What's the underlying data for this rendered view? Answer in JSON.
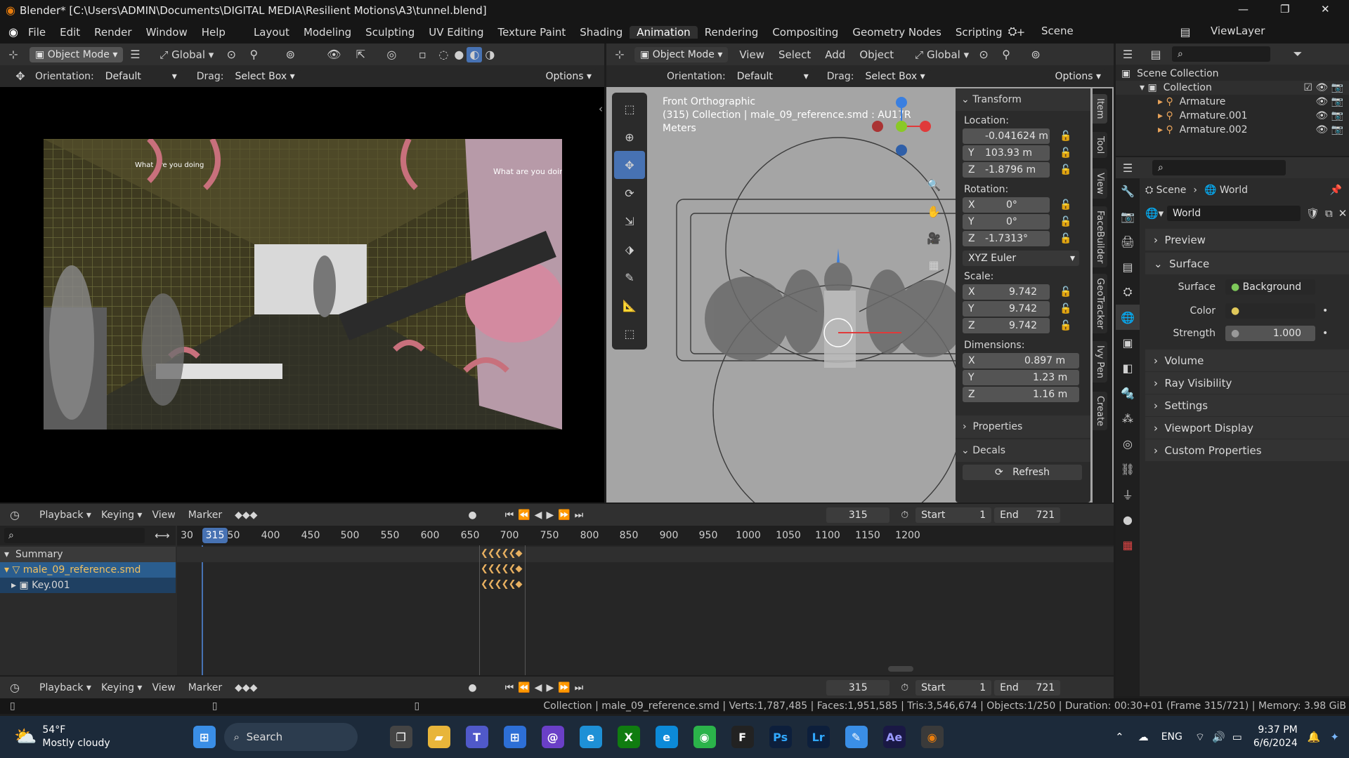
{
  "window": {
    "title": "Blender* [C:\\Users\\ADMIN\\Documents\\DIGITAL MEDIA\\Resilient Motions\\A3\\tunnel.blend]",
    "min": "—",
    "max": "❐",
    "close": "✕"
  },
  "menu": [
    "File",
    "Edit",
    "Render",
    "Window",
    "Help"
  ],
  "workspaces": [
    "Layout",
    "Modeling",
    "Sculpting",
    "UV Editing",
    "Texture Paint",
    "Shading",
    "Animation",
    "Rendering",
    "Compositing",
    "Geometry Nodes",
    "Scripting"
  ],
  "scene_name": "Scene",
  "view_layer": "ViewLayer",
  "left_view": {
    "mode": "Object Mode",
    "transform": "Global",
    "orientation_label": "Orientation:",
    "orientation": "Default",
    "drag_label": "Drag:",
    "drag": "Select Box",
    "options": "Options"
  },
  "right_view": {
    "mode": "Object Mode",
    "menus": [
      "View",
      "Select",
      "Add",
      "Object"
    ],
    "transform": "Global",
    "orientation_label": "Orientation:",
    "orientation": "Default",
    "drag_label": "Drag:",
    "drag": "Select Box",
    "options": "Options",
    "info1": "Front Orthographic",
    "info2": "(315) Collection | male_09_reference.smd : AU17R",
    "info3": "Meters"
  },
  "render_texts": {
    "sign1": "What are you doing",
    "sign2": "What are you doing"
  },
  "transform": {
    "title": "Transform",
    "location_label": "Location:",
    "loc": [
      "-0.041624 m",
      "103.93 m",
      "-1.8796 m"
    ],
    "rotation_label": "Rotation:",
    "rot": [
      "0°",
      "0°",
      "-1.7313°"
    ],
    "rot_mode": "XYZ Euler",
    "scale_label": "Scale:",
    "scale": [
      "9.742",
      "9.742",
      "9.742"
    ],
    "dimensions_label": "Dimensions:",
    "dim": [
      "0.897 m",
      "1.23 m",
      "1.16 m"
    ],
    "axes": [
      "X",
      "Y",
      "Z"
    ],
    "properties": "Properties",
    "decals": "Decals",
    "refresh": "Refresh"
  },
  "side_tabs": [
    "Item",
    "Tool",
    "View",
    "FaceBuilder",
    "GeoTracker",
    "Ivy Pen",
    "Create"
  ],
  "outliner": {
    "scene_collection": "Scene Collection",
    "collection": "Collection",
    "items": [
      "Armature",
      "Armature.001",
      "Armature.002"
    ]
  },
  "props": {
    "breadcrumb1": "Scene",
    "breadcrumb2": "World",
    "world_name": "World",
    "sections": [
      "Preview",
      "Surface",
      "Volume",
      "Ray Visibility",
      "Settings",
      "Viewport Display",
      "Custom Properties"
    ],
    "surface_label": "Surface",
    "surface_value": "Background",
    "color_label": "Color",
    "strength_label": "Strength",
    "strength_value": "1.000"
  },
  "timeline": {
    "menus": [
      "Playback",
      "Keying",
      "View",
      "Marker"
    ],
    "frame": "315",
    "start_label": "Start",
    "start": "1",
    "end_label": "End",
    "end": "721"
  },
  "dopesheet": {
    "ticks": [
      "30",
      "350",
      "400",
      "450",
      "500",
      "550",
      "600",
      "650",
      "700",
      "750",
      "800",
      "850",
      "900",
      "950",
      "1000",
      "1050",
      "1100",
      "1150",
      "1200"
    ],
    "current": "315",
    "channels": [
      "Summary",
      "male_09_reference.smd",
      "Key.001"
    ]
  },
  "status": "Collection | male_09_reference.smd | Verts:1,787,485 | Faces:1,951,585 | Tris:3,546,674 | Objects:1/250 | Duration: 00:30+01 (Frame 315/721) | Memory: 3.98 GiB",
  "taskbar": {
    "temp": "54°F",
    "weather": "Mostly cloudy",
    "search": "Search",
    "lang": "ENG",
    "time": "9:37 PM",
    "date": "6/6/2024",
    "apps": [
      "Ps",
      "Lr",
      "Ae"
    ]
  }
}
